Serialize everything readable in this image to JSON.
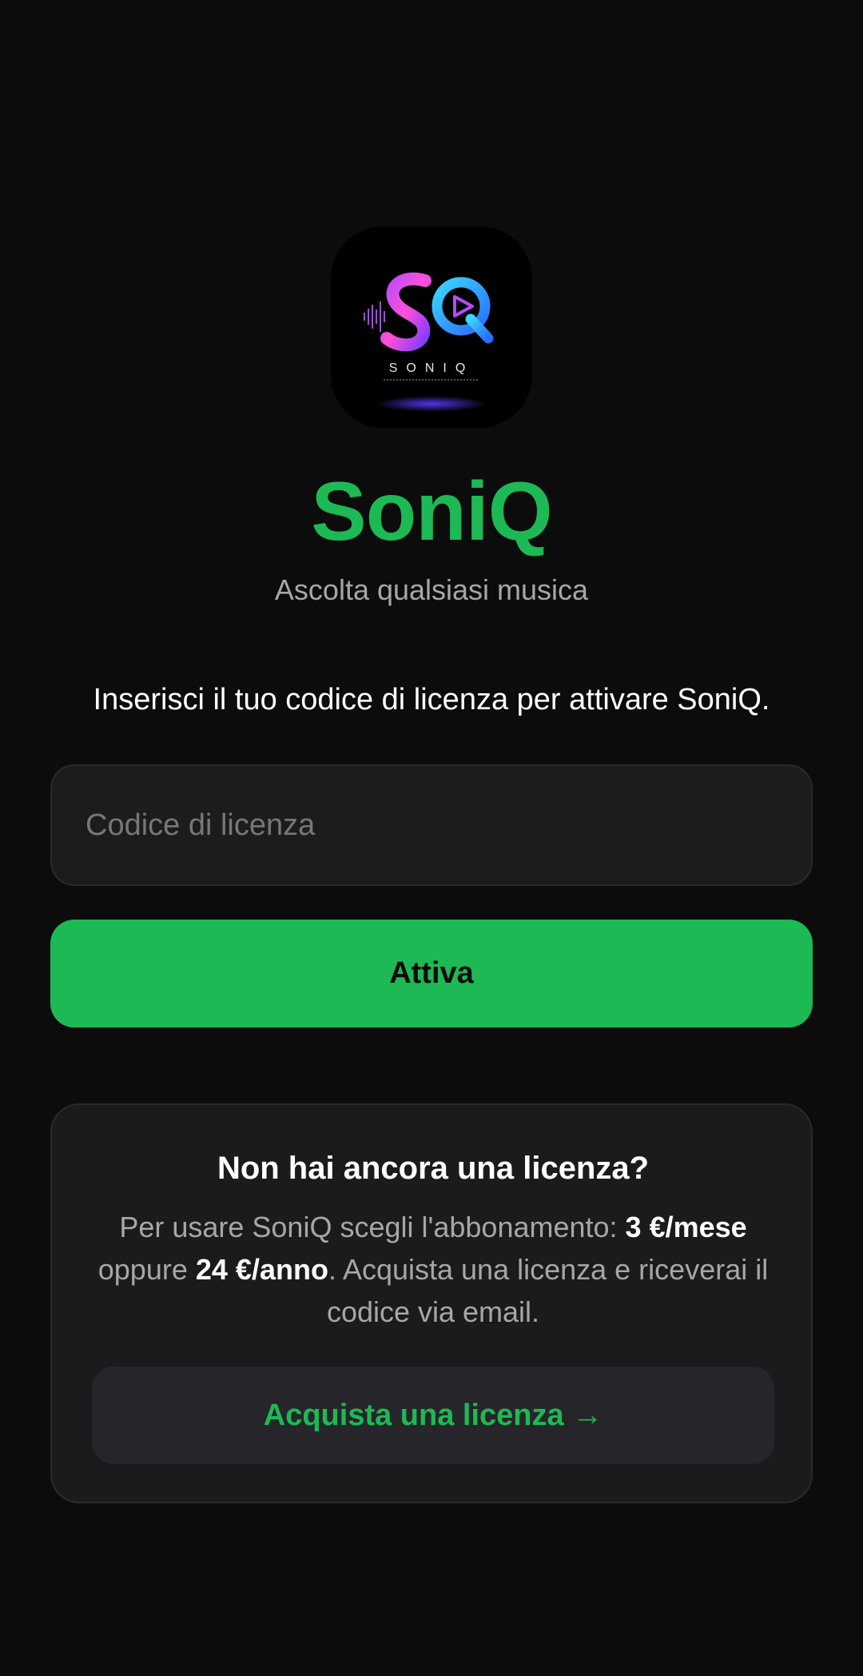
{
  "app": {
    "logo_icon": "soniq-logo-icon",
    "logo_wordmark": "SONIQ",
    "title": "SoniQ",
    "tagline": "Ascolta qualsiasi musica"
  },
  "activation": {
    "instruction": "Inserisci il tuo codice di licenza per attivare SoniQ.",
    "license_placeholder": "Codice di licenza",
    "license_value": "",
    "activate_label": "Attiva"
  },
  "purchase_card": {
    "title": "Non hai ancora una licenza?",
    "body_prefix": "Per usare SoniQ scegli l'abbonamento: ",
    "monthly_price": "3 €/mese",
    "body_middle": " oppure ",
    "yearly_price": "24 €/anno",
    "body_suffix": ". Acquista una licenza e riceverai il codice via email.",
    "buy_label": "Acquista una licenza →"
  },
  "colors": {
    "background": "#0c0c0d",
    "accent": "#1db954",
    "surface": "#1b1b1e",
    "secondary_text": "#a7a7ab"
  }
}
